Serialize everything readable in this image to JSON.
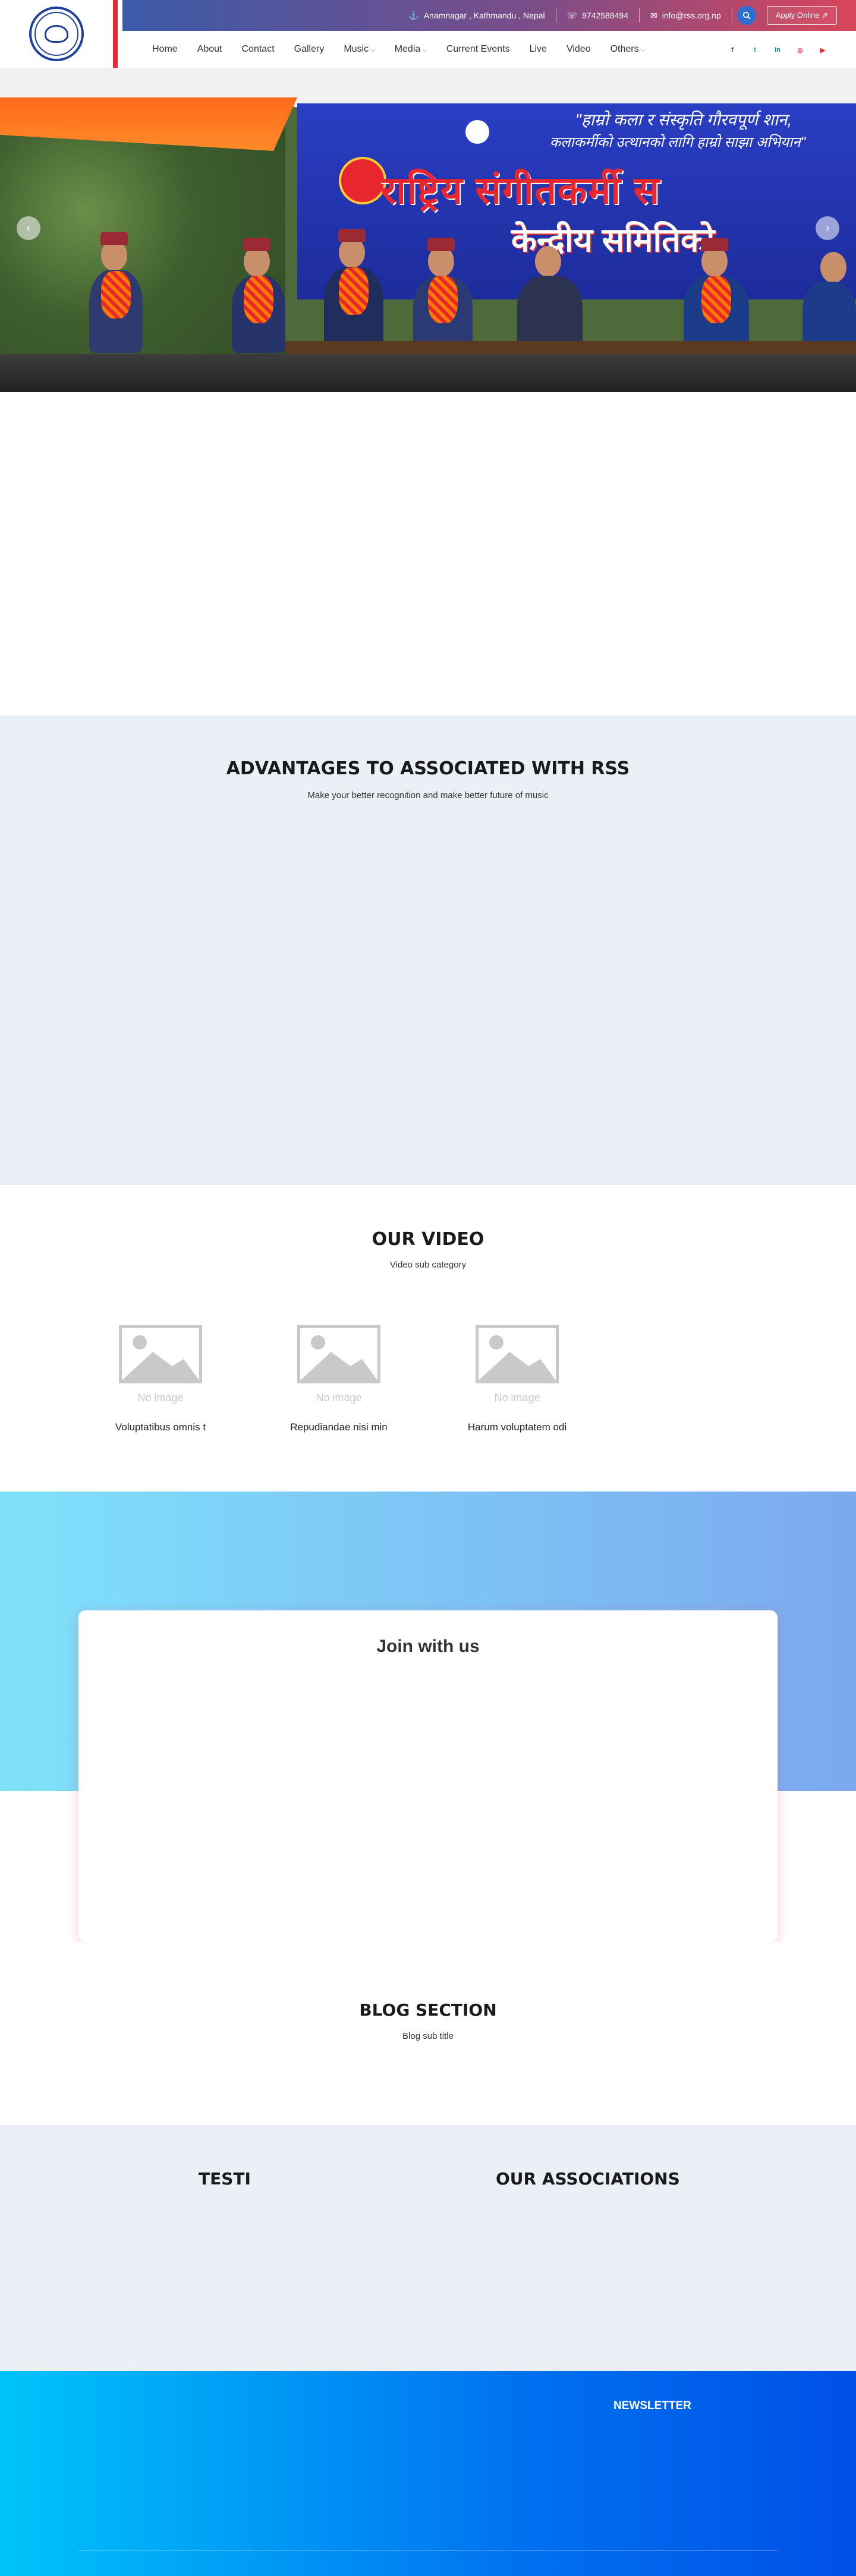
{
  "topbar": {
    "address": "Anamnagar , Kathmandu , Nepal",
    "phone": "9742588494",
    "email": "info@rss.org.np",
    "apply_label": "Apply Online ⇗"
  },
  "nav": {
    "items": [
      {
        "label": "Home"
      },
      {
        "label": "About"
      },
      {
        "label": "Contact"
      },
      {
        "label": "Gallery"
      },
      {
        "label": "Music",
        "dropdown": true
      },
      {
        "label": "Media",
        "dropdown": true
      },
      {
        "label": "Current Events"
      },
      {
        "label": "Live"
      },
      {
        "label": "Video"
      },
      {
        "label": "Others",
        "dropdown": true
      }
    ]
  },
  "socials": {
    "facebook": "f",
    "twitter": "t",
    "linkedin": "in",
    "instagram": "◎",
    "youtube": "▶"
  },
  "hero": {
    "banner_line1": "\"हाम्रो कला र संस्कृति गौरवपूर्ण शान,",
    "banner_line2": "कलाकर्मीको उत्थानको लागि हाम्रो साझा अभियान\"",
    "banner_title": "राष्ट्रिय संगीतकर्मी स",
    "banner_sub": "केन्द्रीय समितिको"
  },
  "advantages": {
    "title": "ADVANTAGES TO ASSOCIATED WITH RSS",
    "subtitle": "Make your better recognition and make better future of music"
  },
  "video": {
    "title": "OUR VIDEO",
    "subtitle": "Video sub category",
    "no_image_label": "No image",
    "items": [
      {
        "title": "Voluptatibus omnis t"
      },
      {
        "title": "Repudiandae nisi min"
      },
      {
        "title": "Harum voluptatem odi"
      }
    ]
  },
  "join": {
    "title": "Join with us"
  },
  "blog": {
    "title": "BLOG SECTION",
    "subtitle": "Blog sub title"
  },
  "testi": {
    "title": "TESTI"
  },
  "associations": {
    "title": "OUR ASSOCIATIONS"
  },
  "footer": {
    "newsletter_title": "NEWSLETTER"
  },
  "colors": {
    "accent_red": "#e8262d",
    "logo_blue": "#1e3f9c",
    "section_bg": "#ebf0f7"
  }
}
